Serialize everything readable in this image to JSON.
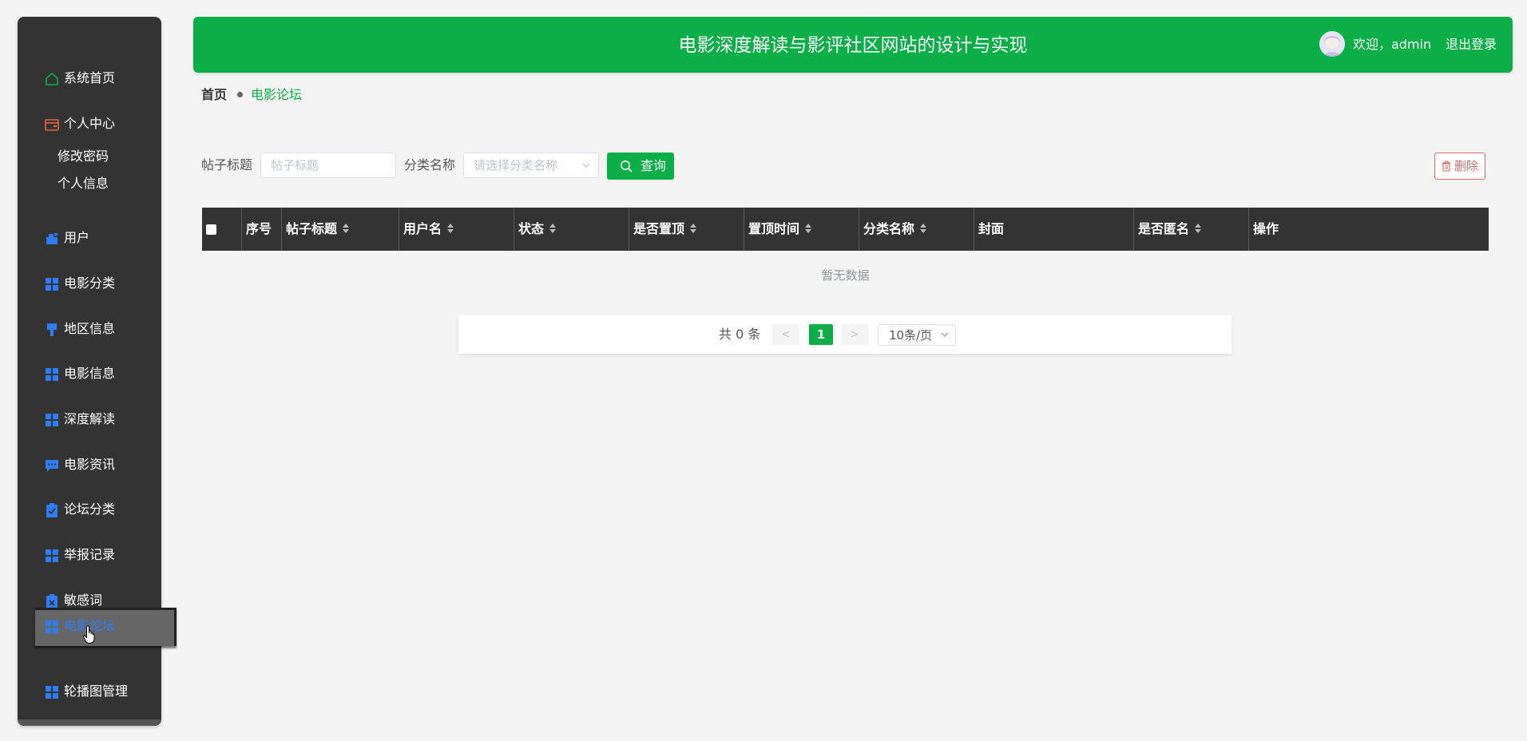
{
  "header": {
    "title": "电影深度解读与影评社区网站的设计与实现",
    "welcome": "欢迎，admin",
    "logout": "退出登录"
  },
  "sidebar": {
    "items": [
      {
        "label": "系统首页",
        "icon": "home-icon"
      },
      {
        "label": "个人中心",
        "icon": "wallet-icon"
      },
      {
        "label": "用户",
        "icon": "user-icon"
      },
      {
        "label": "电影分类",
        "icon": "grid-icon"
      },
      {
        "label": "地区信息",
        "icon": "pin-icon"
      },
      {
        "label": "电影信息",
        "icon": "grid-icon"
      },
      {
        "label": "深度解读",
        "icon": "grid-icon"
      },
      {
        "label": "电影资讯",
        "icon": "chat-icon"
      },
      {
        "label": "论坛分类",
        "icon": "clipboard-icon"
      },
      {
        "label": "举报记录",
        "icon": "grid-icon"
      },
      {
        "label": "敏感词",
        "icon": "clipboard-x-icon"
      },
      {
        "label": "电影论坛",
        "icon": "grid-icon"
      },
      {
        "label": "轮播图管理",
        "icon": "grid-icon"
      }
    ],
    "sub_items": [
      "修改密码",
      "个人信息"
    ],
    "active": "电影论坛"
  },
  "breadcrumb": {
    "home": "首页",
    "current": "电影论坛"
  },
  "search": {
    "title_label": "帖子标题",
    "title_placeholder": "帖子标题",
    "category_label": "分类名称",
    "category_placeholder": "请选择分类名称",
    "query_button": "查询",
    "delete_button": "删除"
  },
  "table": {
    "columns": [
      "序号",
      "帖子标题",
      "用户名",
      "状态",
      "是否置顶",
      "置顶时间",
      "分类名称",
      "封面",
      "是否匿名",
      "操作"
    ],
    "empty_text": "暂无数据"
  },
  "pagination": {
    "total": "共 0 条",
    "prev": "<",
    "next": ">",
    "current_page": "1",
    "page_size": "10条/页"
  },
  "colors": {
    "primary": "#0bae47",
    "sidebar_bg": "#333333",
    "icon_blue": "#2f7df6",
    "icon_green": "#0bae47",
    "icon_orange": "#e8663d",
    "danger": "#d46b6b"
  }
}
